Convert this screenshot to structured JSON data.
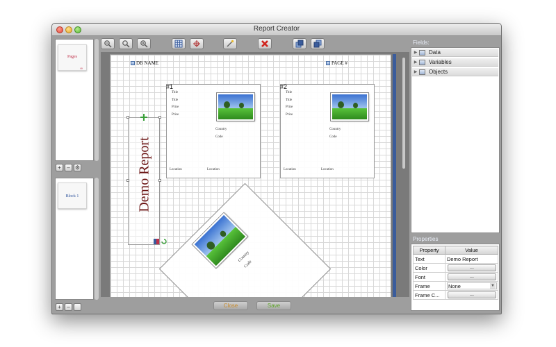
{
  "window": {
    "title": "Report Creator"
  },
  "left_panel": {
    "pages_thumb_label": "Pages",
    "pages_thumb_mark": "∞",
    "blocks_thumb_label": "Block 1",
    "pages_buttons": [
      "+",
      "–",
      "⚙"
    ],
    "blocks_buttons": [
      "+",
      "–",
      ""
    ]
  },
  "toolbar": {
    "tools": [
      "zoom-out",
      "zoom-fit",
      "zoom-in",
      "grid",
      "snap",
      "wand",
      "delete",
      "bring-forward",
      "send-backward"
    ]
  },
  "report": {
    "db_name_field": "DB NAME",
    "page_field": "PAGE #",
    "demo_text": "Demo Report",
    "cards": [
      {
        "number": "#1",
        "lines": [
          "Title",
          "Title",
          "Price",
          "Price"
        ],
        "country": "Country",
        "code": "Code",
        "location_left": "Location",
        "location_right": "Location"
      },
      {
        "number": "#2",
        "lines": [
          "Title",
          "Title",
          "Price",
          "Price"
        ],
        "country": "Country",
        "code": "Code",
        "location_left": "Location",
        "location_right": "Location"
      }
    ],
    "rotated_card": {
      "country": "Country",
      "code": "Code"
    }
  },
  "bottom": {
    "close_label": "Close",
    "save_label": "Save"
  },
  "fields_panel": {
    "title": "Fields:",
    "items": [
      "Data",
      "Variables",
      "Objects"
    ]
  },
  "properties_panel": {
    "title": "Properties",
    "header_property": "Property",
    "header_value": "Value",
    "rows": [
      {
        "property": "Text",
        "value": "Demo Report",
        "kind": "text"
      },
      {
        "property": "Color",
        "value": "...",
        "kind": "button"
      },
      {
        "property": "Font",
        "value": "...",
        "kind": "button"
      },
      {
        "property": "Frame",
        "value": "None",
        "kind": "select"
      },
      {
        "property": "Frame C...",
        "value": "...",
        "kind": "button"
      }
    ]
  },
  "colors": {
    "accent_blue": "#3a5c9c",
    "demo_text": "#6b1414",
    "close_label": "#c98a2a",
    "save_label": "#5fa52a",
    "delete_red": "#d0251e"
  }
}
